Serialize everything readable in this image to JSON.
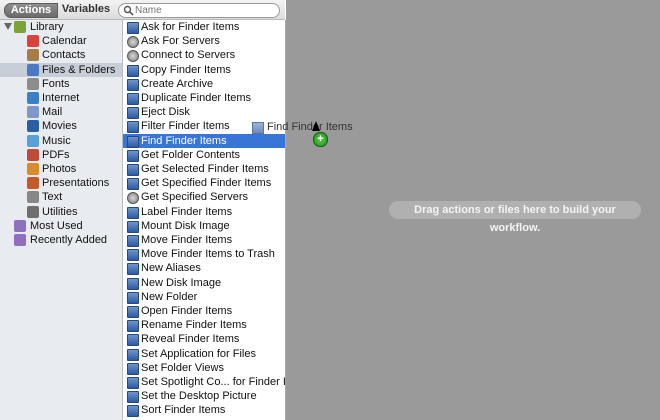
{
  "toolbar": {
    "actions_label": "Actions",
    "variables_label": "Variables"
  },
  "search": {
    "placeholder": "Name"
  },
  "library": {
    "items": [
      {
        "label": "Library",
        "icon": "library-icon",
        "color": "#7aa33a",
        "level": 0,
        "expanded": true
      },
      {
        "label": "Calendar",
        "icon": "calendar-icon",
        "color": "#d8433b",
        "level": 1
      },
      {
        "label": "Contacts",
        "icon": "contacts-icon",
        "color": "#a47d4a",
        "level": 1
      },
      {
        "label": "Files & Folders",
        "icon": "finder-icon",
        "color": "#4f78c4",
        "level": 1,
        "selected": true
      },
      {
        "label": "Fonts",
        "icon": "fonts-icon",
        "color": "#8d8d8d",
        "level": 1
      },
      {
        "label": "Internet",
        "icon": "internet-icon",
        "color": "#3b7fc7",
        "level": 1
      },
      {
        "label": "Mail",
        "icon": "mail-icon",
        "color": "#7d98c7",
        "level": 1
      },
      {
        "label": "Movies",
        "icon": "movies-icon",
        "color": "#2a5fa8",
        "level": 1
      },
      {
        "label": "Music",
        "icon": "music-icon",
        "color": "#5aa0d8",
        "level": 1
      },
      {
        "label": "PDFs",
        "icon": "pdf-icon",
        "color": "#c04a3a",
        "level": 1
      },
      {
        "label": "Photos",
        "icon": "photos-icon",
        "color": "#d88a2d",
        "level": 1
      },
      {
        "label": "Presentations",
        "icon": "presentations-icon",
        "color": "#c45a2a",
        "level": 1
      },
      {
        "label": "Text",
        "icon": "text-icon",
        "color": "#888888",
        "level": 1
      },
      {
        "label": "Utilities",
        "icon": "utilities-icon",
        "color": "#6f6f6f",
        "level": 1
      },
      {
        "label": "Most Used",
        "icon": "smart-folder-icon",
        "color": "#8e6fc0",
        "level": 0
      },
      {
        "label": "Recently Added",
        "icon": "smart-folder-icon",
        "color": "#8e6fc0",
        "level": 0
      }
    ]
  },
  "actions": {
    "items": [
      {
        "label": "Ask for Finder Items"
      },
      {
        "label": "Ask For Servers",
        "round": true
      },
      {
        "label": "Connect to Servers",
        "round": true
      },
      {
        "label": "Copy Finder Items"
      },
      {
        "label": "Create Archive"
      },
      {
        "label": "Duplicate Finder Items"
      },
      {
        "label": "Eject Disk"
      },
      {
        "label": "Filter Finder Items"
      },
      {
        "label": "Find Finder Items",
        "selected": true
      },
      {
        "label": "Get Folder Contents"
      },
      {
        "label": "Get Selected Finder Items"
      },
      {
        "label": "Get Specified Finder Items"
      },
      {
        "label": "Get Specified Servers",
        "round": true
      },
      {
        "label": "Label Finder Items"
      },
      {
        "label": "Mount Disk Image"
      },
      {
        "label": "Move Finder Items"
      },
      {
        "label": "Move Finder Items to Trash"
      },
      {
        "label": "New Aliases"
      },
      {
        "label": "New Disk Image"
      },
      {
        "label": "New Folder"
      },
      {
        "label": "Open Finder Items"
      },
      {
        "label": "Rename Finder Items"
      },
      {
        "label": "Reveal Finder Items"
      },
      {
        "label": "Set Application for Files"
      },
      {
        "label": "Set Folder Views"
      },
      {
        "label": "Set Spotlight Co... for Finder Items"
      },
      {
        "label": "Set the Desktop Picture"
      },
      {
        "label": "Sort Finder Items"
      }
    ]
  },
  "workflow": {
    "hint": "Drag actions or files here to build your workflow.",
    "drag_label": "Find Finder Items",
    "drop_badge": "+"
  }
}
